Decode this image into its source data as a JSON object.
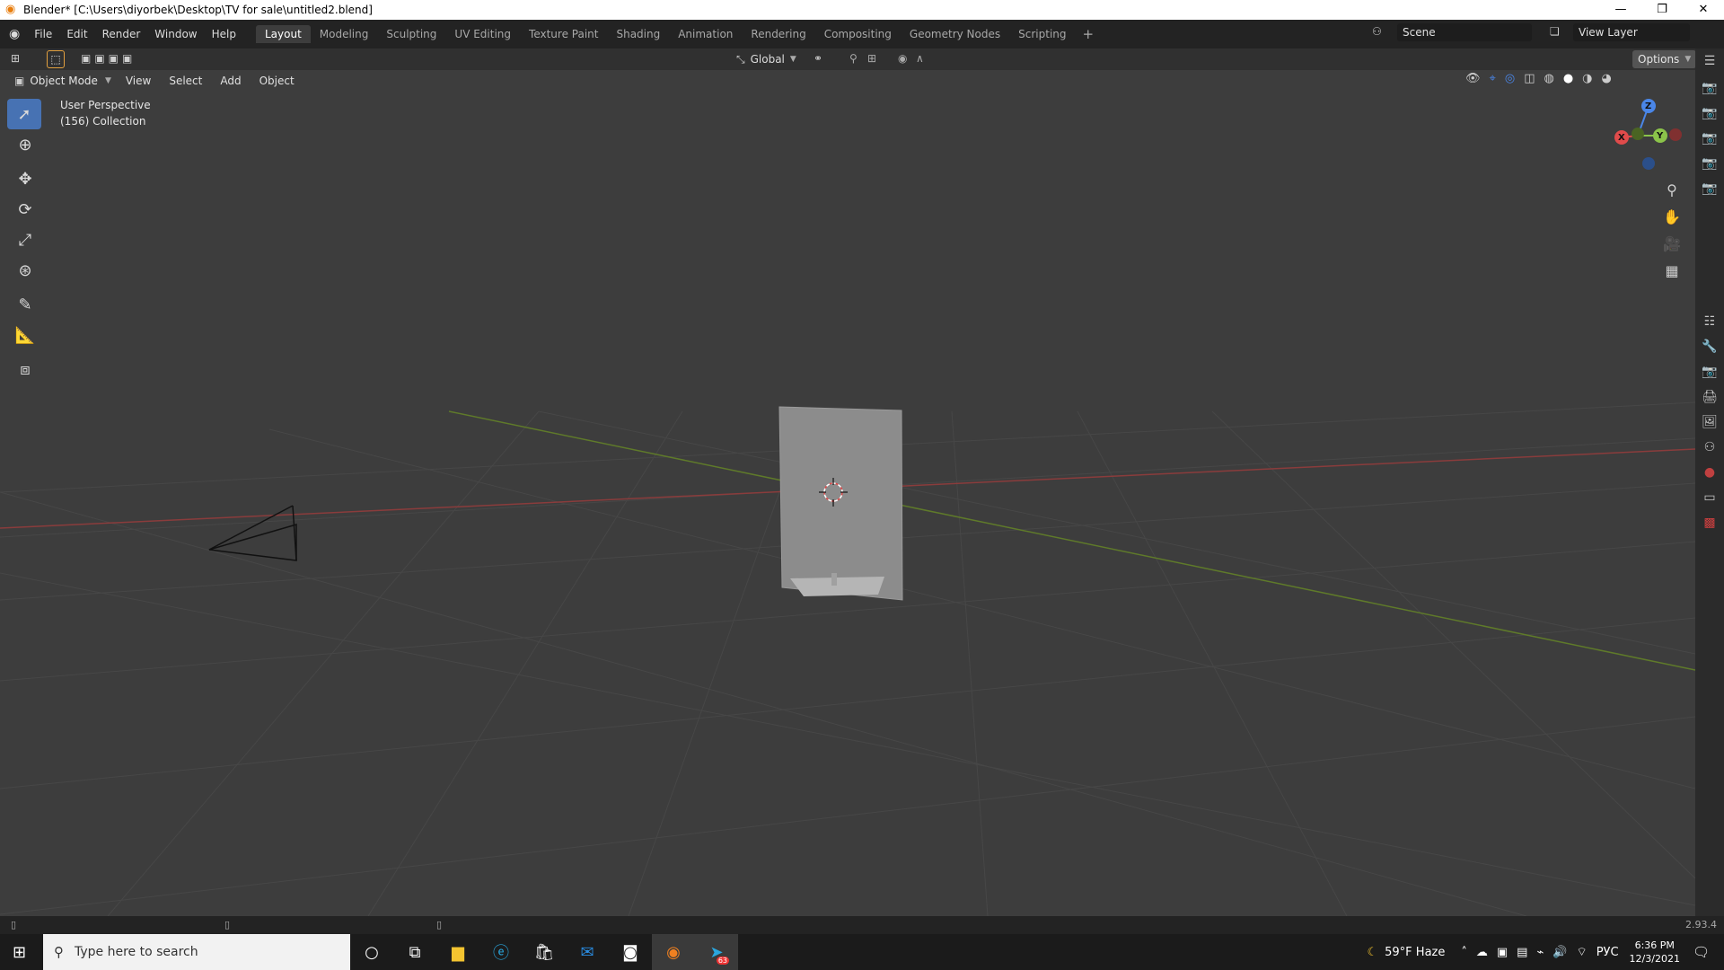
{
  "window": {
    "title": "Blender* [C:\\Users\\diyorbek\\Desktop\\TV for sale\\untitled2.blend]"
  },
  "menu": [
    "File",
    "Edit",
    "Render",
    "Window",
    "Help"
  ],
  "workspaces": [
    "Layout",
    "Modeling",
    "Sculpting",
    "UV Editing",
    "Texture Paint",
    "Shading",
    "Animation",
    "Rendering",
    "Compositing",
    "Geometry Nodes",
    "Scripting"
  ],
  "scene": {
    "name": "Scene",
    "view_layer": "View Layer"
  },
  "tool_header": {
    "orientation": "Global",
    "options_label": "Options"
  },
  "viewport_header": {
    "mode": "Object Mode",
    "menus": [
      "View",
      "Select",
      "Add",
      "Object"
    ]
  },
  "viewport": {
    "perspective_label": "User Perspective",
    "collection_label": "(156) Collection"
  },
  "gizmo": {
    "x": "X",
    "y": "Y",
    "z": "Z"
  },
  "status": {
    "version": "2.93.4"
  },
  "taskbar": {
    "search_placeholder": "Type here to search",
    "weather": "59°F  Haze",
    "lang": "РУС",
    "time": "6:36 PM",
    "date": "12/3/2021",
    "telegram_badge": "63"
  },
  "colors": {
    "accent": "#4772b3",
    "x_axis": "#e04b4b",
    "y_axis": "#8bc34a",
    "z_axis": "#4a86e8"
  }
}
